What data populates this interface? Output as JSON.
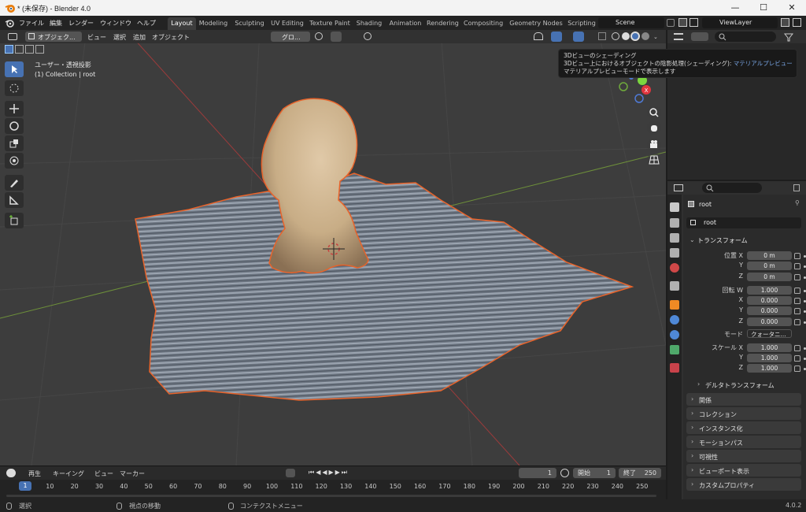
{
  "window": {
    "title": "* (未保存) - Blender 4.0",
    "min_glyph": "—",
    "max_glyph": "☐",
    "close_glyph": "✕"
  },
  "menu": {
    "file": "ファイル",
    "edit": "編集",
    "render": "レンダー",
    "window": "ウィンドウ",
    "help": "ヘルプ"
  },
  "workspaces": [
    "Layout",
    "Modeling",
    "Sculpting",
    "UV Editing",
    "Texture Paint",
    "Shading",
    "Animation",
    "Rendering",
    "Compositing",
    "Geometry Nodes",
    "Scripting"
  ],
  "scene_name": "Scene",
  "view_layer": "ViewLayer",
  "viewport": {
    "mode": "オブジェク...",
    "menu_view": "ビュー",
    "menu_select": "選択",
    "menu_add": "追加",
    "menu_object": "オブジェクト",
    "transform_orientation": "グロ...",
    "view_name": "ユーザー・透視投影",
    "collection_info": "(1) Collection | root"
  },
  "tooltip": {
    "title": "3Dビューのシェーディング",
    "desc_prefix": "3Dビュー上におけるオブジェクトの陰影処理(シェーディング): ",
    "desc_value": "マテリアルプレビュー",
    "desc2": "マテリアルプレビューモードで表示します"
  },
  "gizmo": {
    "x_label": "X"
  },
  "timeline": {
    "playback": "再生",
    "keying": "キーイング",
    "view": "ビュー",
    "marker": "マーカー",
    "current_frame": "1",
    "start_label": "開始",
    "start": "1",
    "end_label": "終了",
    "end": "250",
    "ticks": [
      "10",
      "20",
      "30",
      "40",
      "50",
      "60",
      "70",
      "80",
      "90",
      "100",
      "110",
      "120",
      "130",
      "140",
      "150",
      "160",
      "170",
      "180",
      "190",
      "200",
      "210",
      "220",
      "230",
      "240",
      "250"
    ],
    "playhead": "1"
  },
  "statusbar": {
    "select": "選択",
    "rotate_view": "視点の移動",
    "context_menu": "コンテクストメニュー",
    "version": "4.0.2"
  },
  "properties": {
    "object_name": "root",
    "object_field": "root",
    "transform_header": "トランスフォーム",
    "location_label": "位置 X",
    "location": [
      "0 m",
      "0 m",
      "0 m"
    ],
    "rotation_label": "回転 W",
    "rotation": [
      "1.000",
      "0.000",
      "0.000",
      "0.000"
    ],
    "mode_label": "モード",
    "mode_value": "クォータニ...",
    "scale_label": "スケール X",
    "scale": [
      "1.000",
      "1.000",
      "1.000"
    ],
    "axis_y": "Y",
    "axis_z": "Z",
    "axis_x": "X",
    "delta_transform": "デルタトランスフォーム",
    "panels": [
      "関係",
      "コレクション",
      "インスタンス化",
      "モーションパス",
      "可視性",
      "ビューポート表示",
      "カスタムプロパティ"
    ]
  }
}
